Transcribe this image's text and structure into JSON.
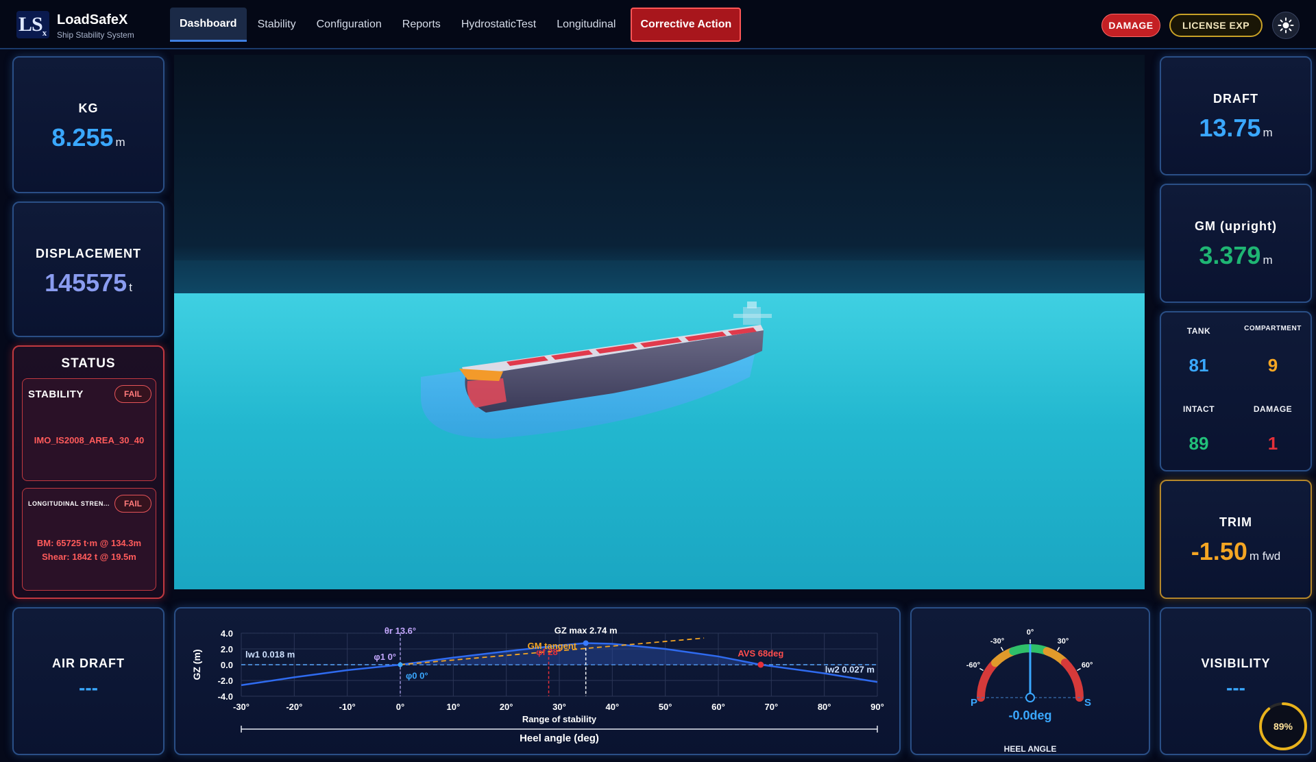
{
  "brand": {
    "mark": "LS",
    "mark_sub": "x",
    "name": "LoadSafeX",
    "subtitle": "Ship Stability System"
  },
  "nav": {
    "tabs": [
      "Dashboard",
      "Stability",
      "Configuration",
      "Reports",
      "HydrostaticTest",
      "Longitudinal"
    ],
    "active": "Dashboard",
    "corrective": "Corrective Action"
  },
  "header": {
    "damage_badge": "DAMAGE",
    "license_badge": "LICENSE EXP",
    "theme_icon": "sun-icon"
  },
  "kg": {
    "title": "KG",
    "value": "8.255",
    "unit": "m"
  },
  "displacement": {
    "title": "DISPLACEMENT",
    "value": "145575",
    "unit": "t"
  },
  "status": {
    "title": "STATUS",
    "stability": {
      "label": "STABILITY",
      "badge": "FAIL",
      "detail": "IMO_IS2008_AREA_30_40"
    },
    "longitudinal": {
      "label": "LONGITUDINAL STREN...",
      "badge": "FAIL",
      "bm": "BM: 65725 t·m @ 134.3m",
      "shear": "Shear: 1842 t @ 19.5m"
    }
  },
  "air_draft": {
    "title": "AIR DRAFT",
    "value": "---"
  },
  "draft": {
    "title": "DRAFT",
    "value": "13.75",
    "unit": "m"
  },
  "gm": {
    "title": "GM (upright)",
    "value": "3.379",
    "unit": "m"
  },
  "tanks": {
    "tank_label": "TANK",
    "tank_value": "81",
    "compartment_label": "COMPARTMENT",
    "compartment_value": "9",
    "intact_label": "INTACT",
    "intact_value": "89",
    "damage_label": "DAMAGE",
    "damage_value": "1"
  },
  "trim": {
    "title": "TRIM",
    "value": "-1.50",
    "unit": "m fwd"
  },
  "visibility": {
    "title": "VISIBILITY",
    "value": "---",
    "progress_label": "89%",
    "progress": 0.89
  },
  "heel": {
    "title": "HEEL ANGLE",
    "readout": "-0.0deg",
    "heel_deg": 0,
    "ticks": [
      "-60°",
      "-30°",
      "0°",
      "30°",
      "60°"
    ],
    "port": "P",
    "starboard": "S"
  },
  "colors": {
    "accent": "#3aa8ff",
    "good": "#22c07a",
    "warn": "#f5a623",
    "danger": "#e5303a",
    "gm_green": "#1fb573"
  },
  "chart_data": {
    "type": "line",
    "xlabel": "Heel angle (deg)",
    "ylabel": "GZ (m)",
    "xlim": [
      -30,
      90
    ],
    "ylim": [
      -4,
      4
    ],
    "x_ticks": [
      "-30°",
      "-20°",
      "-10°",
      "0°",
      "10°",
      "20°",
      "30°",
      "40°",
      "50°",
      "60°",
      "70°",
      "80°",
      "90°"
    ],
    "y_ticks": [
      "4.0",
      "2.0",
      "0.0",
      "-2.0",
      "-4.0"
    ],
    "series": [
      {
        "x": [
          -30,
          -20,
          -10,
          0,
          10,
          20,
          30,
          35,
          40,
          50,
          60,
          68,
          80,
          90
        ],
        "y": [
          -2.6,
          -1.6,
          -0.7,
          0.0,
          0.9,
          1.7,
          2.45,
          2.74,
          2.65,
          2.0,
          1.05,
          0.0,
          -1.1,
          -2.2
        ]
      }
    ],
    "gm_tangent": {
      "label": "GM tangent",
      "x": [
        0,
        57.3
      ],
      "y": [
        0,
        3.38
      ]
    },
    "annotations": [
      {
        "text": "θr 13.6°",
        "x": 0,
        "y": 3.4
      },
      {
        "text": "GZ max 2.74 m",
        "x": 35,
        "y": 2.74
      },
      {
        "text": "φf 28°",
        "x": 28,
        "y": 1.2
      },
      {
        "text": "φ1 0°",
        "x": 0,
        "y": 0.6
      },
      {
        "text": "φ0 0°",
        "x": 0,
        "y": -1.8
      },
      {
        "text": "AVS 68deg",
        "x": 68,
        "y": 0
      },
      {
        "text": "lw1 0.018 m",
        "x": -30,
        "y": 0.9
      },
      {
        "text": "lw2 0.027 m",
        "x": 90,
        "y": -1
      }
    ],
    "range_label": "Range of stability",
    "legend": "none",
    "grid": true
  }
}
